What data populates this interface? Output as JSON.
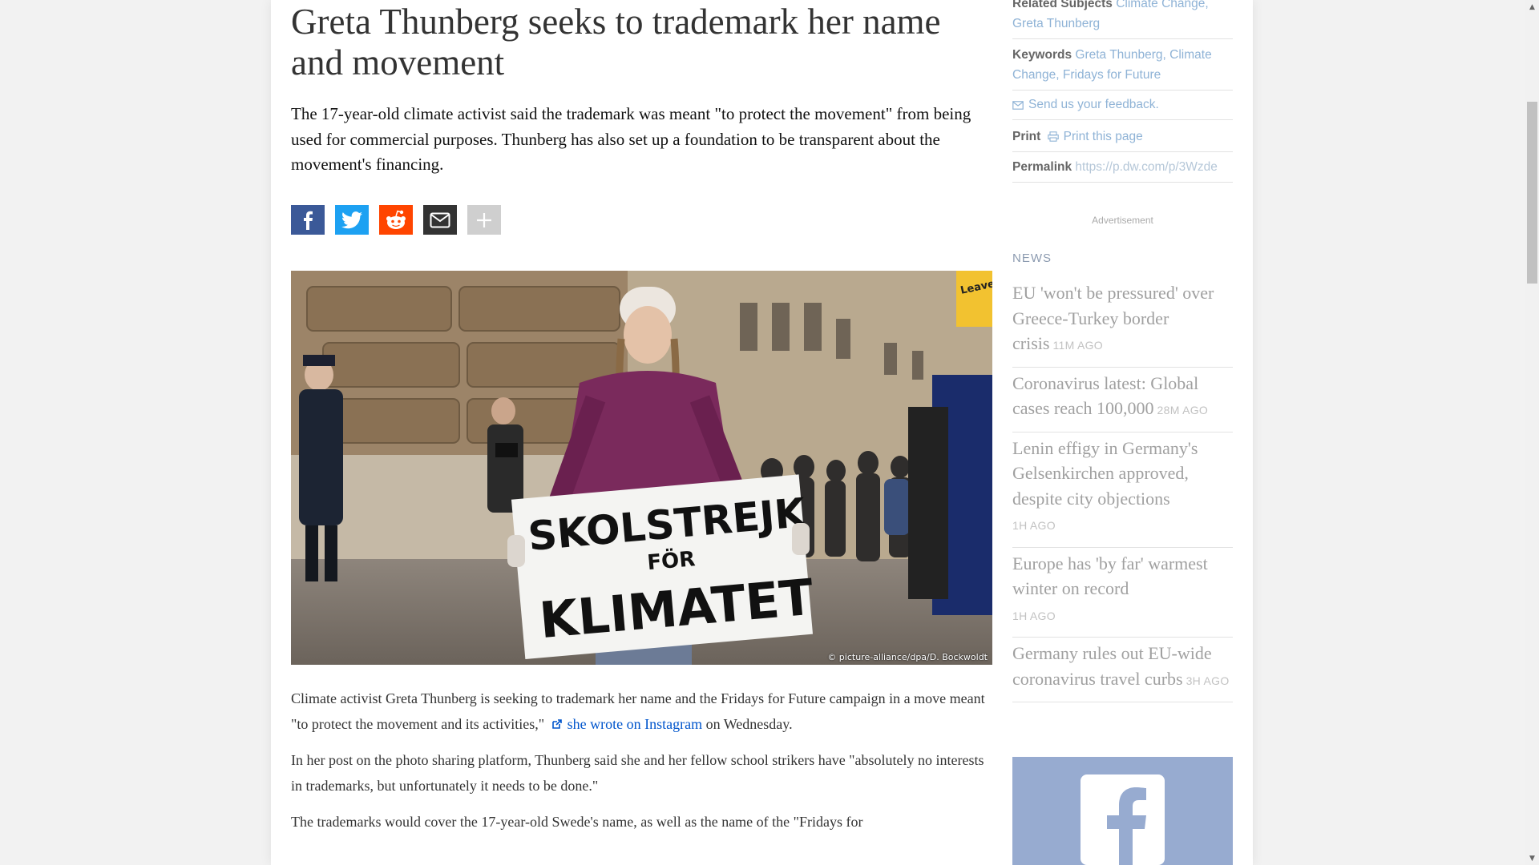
{
  "article": {
    "headline": "Greta Thunberg seeks to trademark her name and movement",
    "lead": "The 17-year-old climate activist said the trademark was meant \"to protect the movement\" from being used for commercial purposes. Thunberg has also set up a foundation to be transparent about the movement's financing.",
    "photo_sign_line1": "SKOLSTREJK",
    "photo_sign_line2": "FÖR",
    "photo_sign_line3": "KLIMATET",
    "photo_banner_text": "Leave",
    "photo_credit": "© picture-alliance/dpa/D. Bockwoldt",
    "p1_before": "Climate activist Greta Thunberg is seeking to trademark her name and the Fridays for Future campaign in a move meant \"to protect the movement and its activities,\"",
    "p1_link": "she wrote on Instagram",
    "p1_after": "on Wednesday.",
    "p2": "In her post on the photo sharing platform, Thunberg said she and her fellow school strikers have \"absolutely no interests in trademarks, but unfortunately it needs to be done.\"",
    "p3": "The trademarks would cover the 17-year-old Swede's name, as well as the name of the \"Fridays for"
  },
  "share": {
    "icons": [
      "facebook-icon",
      "twitter-icon",
      "reddit-icon",
      "mail-icon",
      "plus-icon"
    ]
  },
  "sidebar": {
    "related_label": "Related Subjects",
    "related_links": "Climate Change,",
    "related_links2": "Greta Thunberg",
    "keywords_label": "Keywords",
    "keywords_links": "Greta Thunberg, Climate",
    "keywords_links2": "Change, Fridays for Future",
    "feedback": "Send us your feedback.",
    "print_label": "Print",
    "print_link": "Print this page",
    "permalink_label": "Permalink",
    "permalink_url": "https://p.dw.com/p/3Wzde",
    "ad_label": "Advertisement",
    "news_heading": "NEWS",
    "news": [
      {
        "title": "EU 'won't be pressured' over Greece-Turkey border crisis",
        "time": "11M AGO"
      },
      {
        "title": "Coronavirus latest: Global cases reach 100,000",
        "time": "28M AGO"
      },
      {
        "title": "Lenin effigy in Germany's Gelsenkirchen approved, despite city objections",
        "time": "1H AGO"
      },
      {
        "title": "Europe has 'by far' warmest winter on record",
        "time": "1H AGO"
      },
      {
        "title": "Germany rules out EU-wide coronavirus travel curbs",
        "time": "3H AGO"
      }
    ]
  },
  "colors": {
    "facebook": "#3b5998",
    "twitter": "#1da1f2",
    "reddit": "#ff4500",
    "mail": "#333333",
    "link": "#0055cc",
    "sidebar_link": "#8fb3d6"
  }
}
